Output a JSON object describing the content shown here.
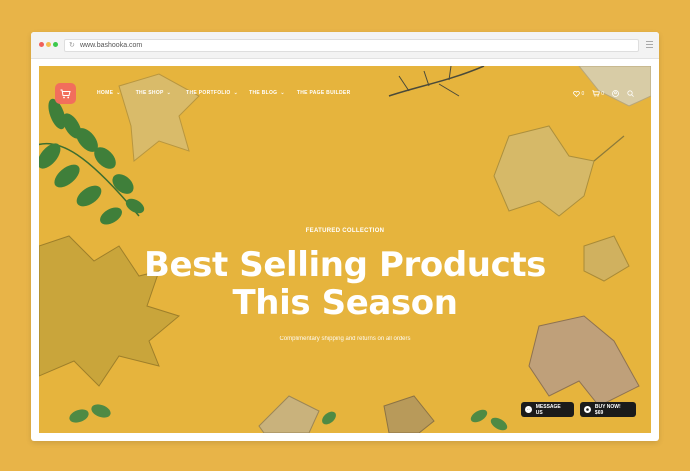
{
  "browser": {
    "url": "www.bashooka.com"
  },
  "nav": {
    "items": [
      {
        "label": "HOME"
      },
      {
        "label": "THE SHOP"
      },
      {
        "label": "THE PORTFOLIO"
      },
      {
        "label": "THE BLOG"
      },
      {
        "label": "THE PAGE BUILDER"
      }
    ],
    "wishlist_count": "0",
    "cart_count": "0"
  },
  "hero": {
    "eyebrow": "FEATURED COLLECTION",
    "headline_line1": "Best Selling Products",
    "headline_line2": "This Season",
    "subline": "Complimentary shipping and returns on all orders"
  },
  "actions": {
    "message_label": "MESSAGE US",
    "buy_label": "BUY NOW! $69"
  },
  "colors": {
    "page_background": "#E8B448",
    "hero_background": "#E6B43D",
    "logo_accent": "#F26E5C",
    "button_dark": "#1B1B1B"
  },
  "icons": [
    "reload-icon",
    "browser-menu-icon",
    "cart-logo-icon",
    "heart-icon",
    "cart-icon",
    "account-icon",
    "search-icon",
    "messenger-icon",
    "buy-icon"
  ]
}
